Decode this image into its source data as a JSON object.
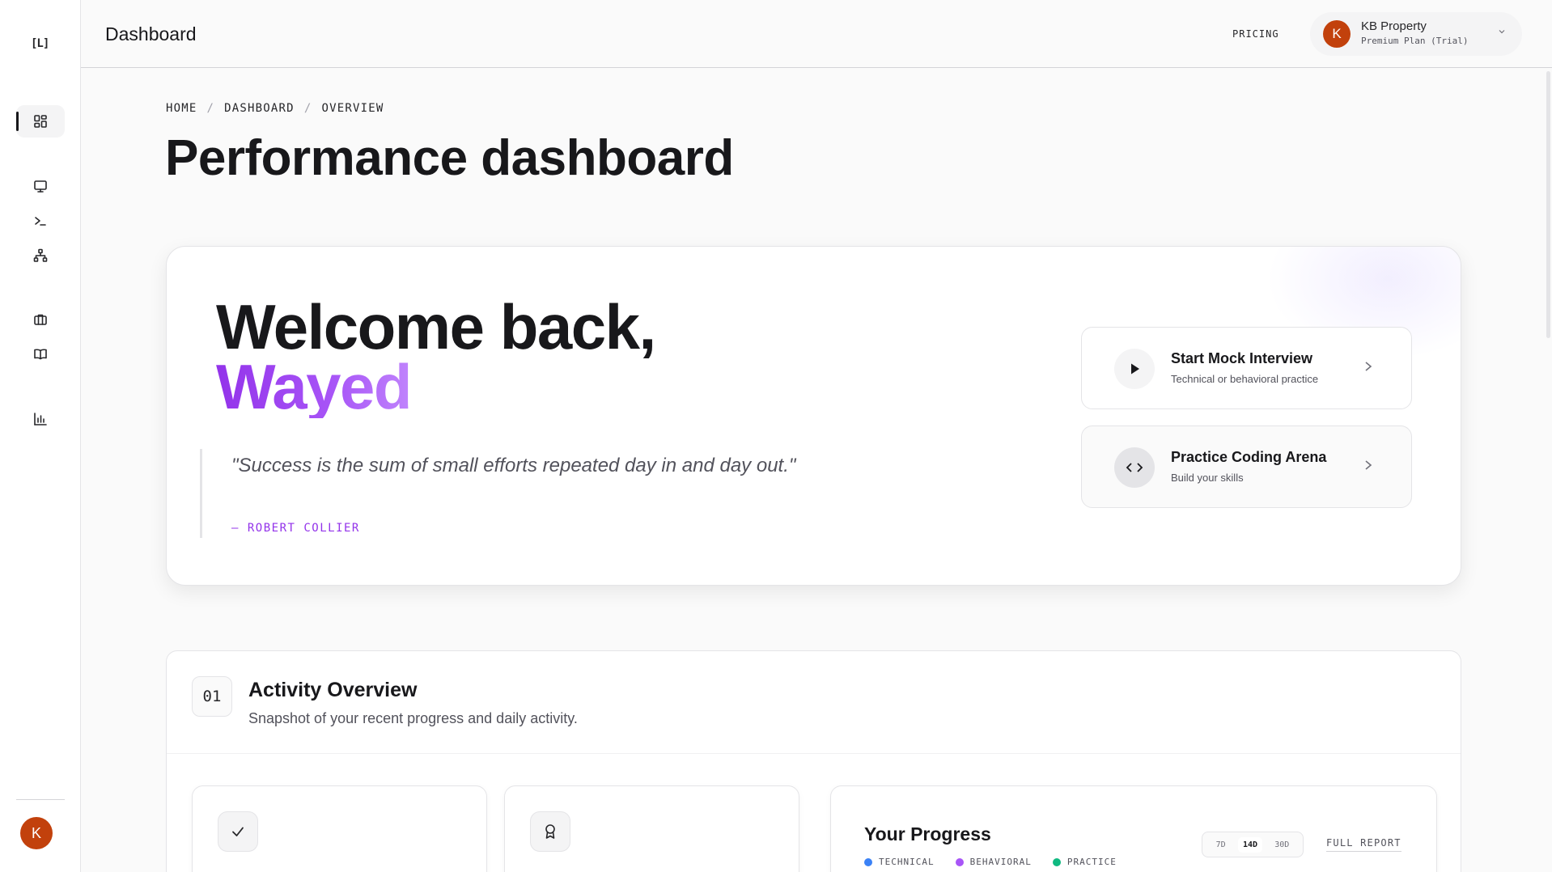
{
  "sidebar": {
    "logo": "[L]",
    "avatar_initial": "K"
  },
  "header": {
    "title": "Dashboard",
    "pricing_label": "PRICING",
    "user": {
      "initial": "K",
      "name": "KB Property",
      "plan": "Premium Plan (Trial)"
    }
  },
  "breadcrumb": [
    "HOME",
    "DASHBOARD",
    "OVERVIEW"
  ],
  "page_title": "Performance dashboard",
  "hero": {
    "welcome": "Welcome back,",
    "name": "Wayed",
    "quote": "\"Success is the sum of small efforts repeated day in and day out.\"",
    "author": "— ROBERT COLLIER",
    "actions": [
      {
        "title": "Start Mock Interview",
        "subtitle": "Technical or behavioral practice",
        "icon": "play-icon"
      },
      {
        "title": "Practice Coding Arena",
        "subtitle": "Build your skills",
        "icon": "code-icon"
      }
    ]
  },
  "activity": {
    "number": "01",
    "title": "Activity Overview",
    "subtitle": "Snapshot of your recent progress and daily activity."
  },
  "progress": {
    "title": "Your Progress",
    "legend": [
      {
        "label": "TECHNICAL",
        "color": "#3b82f6"
      },
      {
        "label": "BEHAVIORAL",
        "color": "#a855f7"
      },
      {
        "label": "PRACTICE",
        "color": "#10b981"
      }
    ],
    "ranges": [
      "7D",
      "14D",
      "30D"
    ],
    "active_range": "14D",
    "full_report_label": "FULL REPORT"
  },
  "colors": {
    "accent": "#9333ea",
    "avatar": "#c2410c"
  }
}
